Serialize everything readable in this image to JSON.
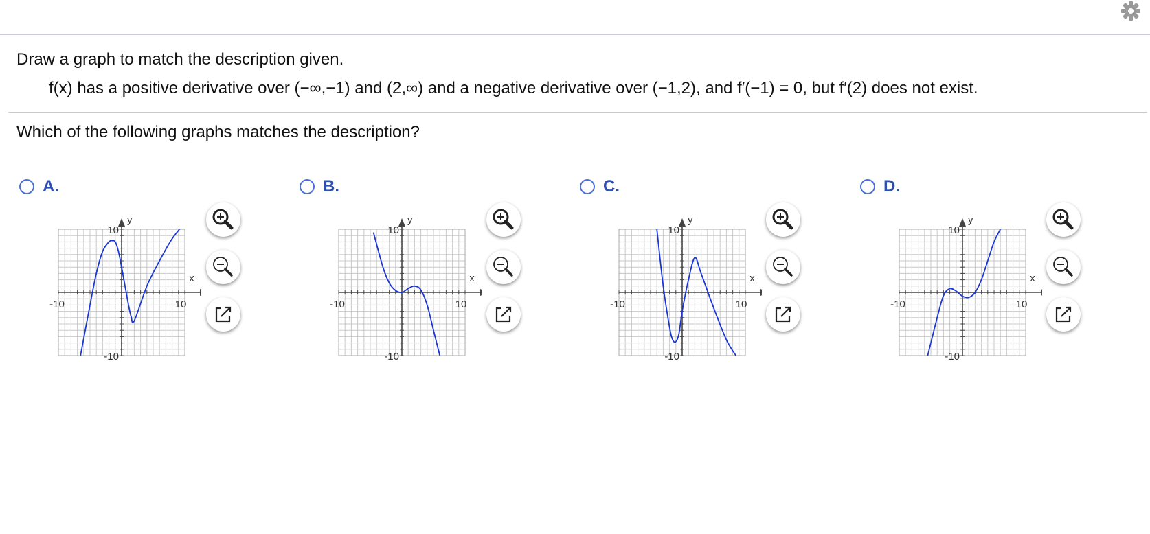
{
  "header": {
    "settings_icon": "gear-icon"
  },
  "question": {
    "instruction": "Draw a graph to match the description given.",
    "description": "f(x) has a positive derivative over (−∞,−1) and (2,∞) and a negative derivative over (−1,2), and f′(−1) = 0, but f′(2) does not exist.",
    "prompt": "Which of the following graphs matches the description?"
  },
  "options": [
    {
      "letter": "A.",
      "id": "a",
      "selected": false
    },
    {
      "letter": "B.",
      "id": "b",
      "selected": false
    },
    {
      "letter": "C.",
      "id": "c",
      "selected": false
    },
    {
      "letter": "D.",
      "id": "d",
      "selected": false
    }
  ],
  "graph_labels": {
    "x_axis": "x",
    "y_axis": "y",
    "x_min": "-10",
    "x_max": "10",
    "y_max": "10",
    "y_min": "-10"
  },
  "graph_tools": [
    "zoom-in-icon",
    "zoom-out-icon",
    "popout-icon"
  ],
  "colors": {
    "curve": "#1a36d8",
    "radio": "#4a6fd8",
    "option_label": "#2c4fb0",
    "grid": "#c8c8c8",
    "axis": "#444444"
  },
  "chart_data": [
    {
      "type": "line",
      "option": "A.",
      "xlim": [
        -10,
        10
      ],
      "ylim": [
        -10,
        10
      ],
      "grid": true,
      "x": [
        -6.5,
        -5,
        -4,
        -3,
        -2,
        -1.5,
        -1,
        -0.5,
        0,
        1,
        1.5,
        2,
        4,
        6,
        8,
        10
      ],
      "y": [
        -10,
        -2,
        3,
        6.5,
        8,
        8.2,
        8,
        6.5,
        4,
        -1.5,
        -3.8,
        -4.5,
        1,
        5,
        8.5,
        11
      ]
    },
    {
      "type": "line",
      "option": "B.",
      "xlim": [
        -10,
        10
      ],
      "ylim": [
        -10,
        10
      ],
      "grid": true,
      "x": [
        -4.5,
        -3,
        -2,
        -1,
        0,
        1,
        2,
        3,
        4,
        5,
        6
      ],
      "y": [
        9.5,
        4,
        1.5,
        0.3,
        0,
        0.6,
        1,
        0.4,
        -2,
        -6,
        -10
      ]
    },
    {
      "type": "line",
      "option": "C.",
      "xlim": [
        -10,
        10
      ],
      "ylim": [
        -10,
        10
      ],
      "grid": true,
      "x": [
        -4,
        -3,
        -2,
        -1.5,
        -1,
        -0.5,
        0,
        1,
        2,
        3,
        5,
        7,
        8.5
      ],
      "y": [
        10,
        1,
        -5.5,
        -7.5,
        -7.8,
        -6.5,
        -3,
        2,
        5.5,
        3,
        -2.5,
        -7.5,
        -10
      ]
    },
    {
      "type": "line",
      "option": "D.",
      "xlim": [
        -10,
        10
      ],
      "ylim": [
        -10,
        10
      ],
      "grid": true,
      "x": [
        -5.5,
        -4,
        -3,
        -2,
        -1,
        0,
        1,
        2,
        3,
        4,
        5,
        6
      ],
      "y": [
        -10,
        -4,
        -0.5,
        0.6,
        0.2,
        -0.6,
        -0.8,
        0,
        2,
        5,
        8,
        10
      ]
    }
  ]
}
